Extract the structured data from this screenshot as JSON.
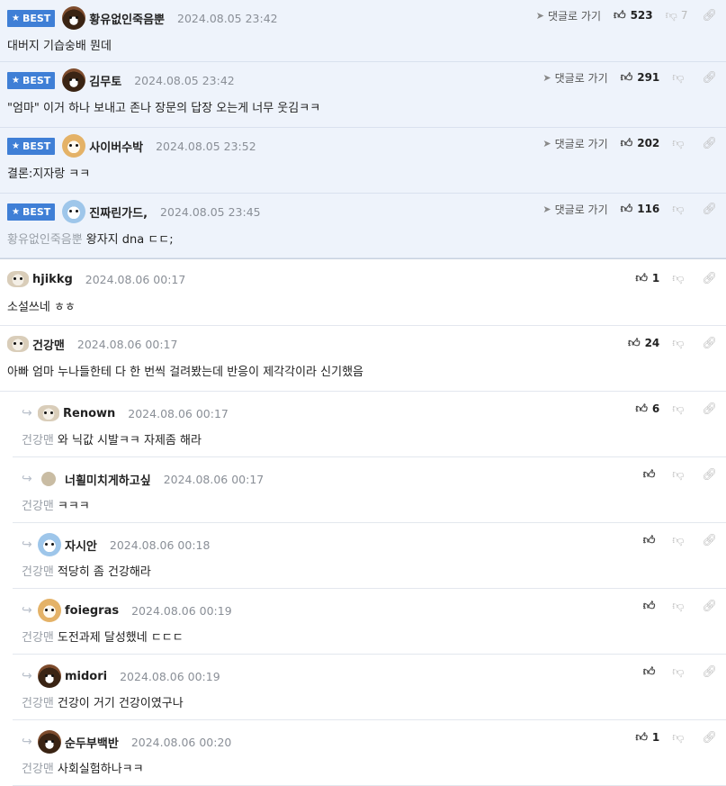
{
  "labels": {
    "goto": "댓글로 가기"
  },
  "best": [
    {
      "badge": "BEST",
      "nick": "황유없인죽음뿐",
      "date": "2024.08.05 23:42",
      "text": "대버지 기습숭배 뭔데",
      "up": "523",
      "down": "7",
      "avatar": "bear"
    },
    {
      "badge": "BEST",
      "nick": "김무토",
      "date": "2024.08.05 23:42",
      "text": "\"엄마\" 이거 하나 보내고 존나 장문의 답장 오는게 너무 웃김ㅋㅋ",
      "up": "291",
      "down": "",
      "avatar": "bear"
    },
    {
      "badge": "BEST",
      "nick": "사이버수박",
      "date": "2024.08.05 23:52",
      "text": "결론:지자랑 ㅋㅋ",
      "up": "202",
      "down": "",
      "avatar": "fox"
    },
    {
      "badge": "BEST",
      "nick": "진짜린가드,",
      "date": "2024.08.05 23:45",
      "mention": "황유없인죽음뿐",
      "text": "왕자지 dna ㄷㄷ;",
      "up": "116",
      "down": "",
      "avatar": "blue"
    }
  ],
  "comments": [
    {
      "type": "normal",
      "nick": "hjikkg",
      "date": "2024.08.06 00:17",
      "text": "소설쓰네 ㅎㅎ",
      "up": "1",
      "avatar": "pup"
    },
    {
      "type": "normal",
      "nick": "건강맨",
      "date": "2024.08.06 00:17",
      "text": "아빠 엄마 누나들한테 다 한 번씩 걸려봤는데 반응이 제각각이라 신기했음",
      "up": "24",
      "avatar": "pup"
    },
    {
      "type": "reply",
      "nick": "Renown",
      "date": "2024.08.06 00:17",
      "mention": "건강맨",
      "text": "와 닉값 시발ㅋㅋ 자제좀 해라",
      "up": "6",
      "avatar": "pup"
    },
    {
      "type": "reply",
      "nick": "너흴미치게하고싶",
      "date": "2024.08.06 00:17",
      "mention": "건강맨",
      "text": "ㅋㅋㅋ",
      "up": "",
      "avatar": "dot"
    },
    {
      "type": "reply",
      "nick": "자시안",
      "date": "2024.08.06 00:18",
      "mention": "건강맨",
      "text": "적당히 좀 건강해라",
      "up": "",
      "avatar": "blue"
    },
    {
      "type": "reply",
      "nick": "foiegras",
      "date": "2024.08.06 00:19",
      "mention": "건강맨",
      "text": "도전과제 달성했네 ㄷㄷㄷ",
      "up": "",
      "avatar": "fox"
    },
    {
      "type": "reply",
      "nick": "midori",
      "date": "2024.08.06 00:19",
      "mention": "건강맨",
      "text": "건강이 거기 건강이였구나",
      "up": "",
      "avatar": "bear"
    },
    {
      "type": "reply",
      "nick": "순두부백반",
      "date": "2024.08.06 00:20",
      "mention": "건강맨",
      "text": "사회실험하나ㅋㅋ",
      "up": "1",
      "avatar": "bear"
    }
  ]
}
